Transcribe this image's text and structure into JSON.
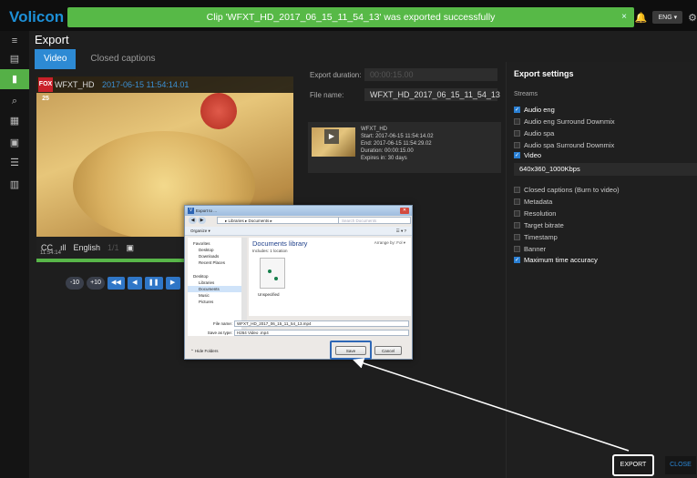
{
  "app": {
    "logo": "Volicon / V",
    "toast": "Clip 'WFXT_HD_2017_06_15_11_54_13' was exported successfully",
    "toast_close": "×",
    "language": "ENG ▾"
  },
  "page": {
    "title": "Export",
    "tabs": [
      {
        "label": "Video",
        "active": true
      },
      {
        "label": "Closed captions",
        "active": false
      }
    ]
  },
  "player": {
    "channel_badge": "FOX 25",
    "channel": "WFXT_HD",
    "timestamp": "2017-06-15 11:54:14.01",
    "controls": {
      "cc": "CC",
      "audio": "ıll",
      "language": "English",
      "speed": "1/1"
    },
    "timecode": "11:54:14",
    "buttons": [
      "-10",
      "+10",
      "◀◀",
      "◀",
      "❚❚",
      "▶"
    ]
  },
  "export_form": {
    "duration_label": "Export duration:",
    "duration_value": "00:00:15.00",
    "filename_label": "File name:",
    "filename_value": "WFXT_HD_2017_06_15_11_54_13",
    "clip": {
      "name": "WFXT_HD",
      "start": "Start: 2017-06-15 11:54:14.02",
      "end": "End: 2017-06-15 11:54:29.02",
      "duration": "Duration: 00:00:15.00",
      "expires": "Expires in: 30 days"
    }
  },
  "settings": {
    "title": "Export settings",
    "streams_label": "Streams",
    "streams": [
      {
        "label": "Audio eng",
        "checked": true
      },
      {
        "label": "Audio eng Surround Downmix",
        "checked": false
      },
      {
        "label": "Audio spa",
        "checked": false
      },
      {
        "label": "Audio spa Surround Downmix",
        "checked": false
      },
      {
        "label": "Video",
        "checked": true
      }
    ],
    "video_preset": "640x360_1000Kbps",
    "options": [
      {
        "label": "Closed captions (Burn to video)",
        "checked": false
      },
      {
        "label": "Metadata",
        "checked": false
      },
      {
        "label": "Resolution",
        "checked": false
      },
      {
        "label": "Target bitrate",
        "checked": false
      },
      {
        "label": "Timestamp",
        "checked": false
      },
      {
        "label": "Banner",
        "checked": false
      },
      {
        "label": "Maximum time accuracy",
        "checked": true
      }
    ]
  },
  "actions": {
    "export": "EXPORT",
    "close": "CLOSE"
  },
  "dialog": {
    "title": "Export to ...",
    "address": "▸ Libraries ▸ Documents ▸",
    "search_placeholder": "Search Documents",
    "organize": "Organize ▾",
    "view": "☰ ▾",
    "help": "?",
    "nav": {
      "favorites": "Favorites",
      "desktop": "Desktop",
      "downloads": "Downloads",
      "recent": "Recent Places",
      "desktop2": "Desktop",
      "libraries": "Libraries",
      "documents": "Documents",
      "music": "Music",
      "pictures": "Pictures"
    },
    "library_title": "Documents library",
    "library_includes": "Includes: 1 location",
    "arrange_by": "Arrange by:  Fol ▾",
    "folder_name": "Unspecified",
    "filename_label": "File name:",
    "filename_value": "WFXT_HD_2017_06_15_11_54_13.mp4",
    "savetype_label": "Save as type:",
    "savetype_value": "H264 Video .mp4",
    "hide_folders": "Hide Folders",
    "save": "Save",
    "cancel": "Cancel"
  },
  "colors": {
    "accent_green": "#57b947",
    "accent_blue": "#2d8ad4"
  }
}
